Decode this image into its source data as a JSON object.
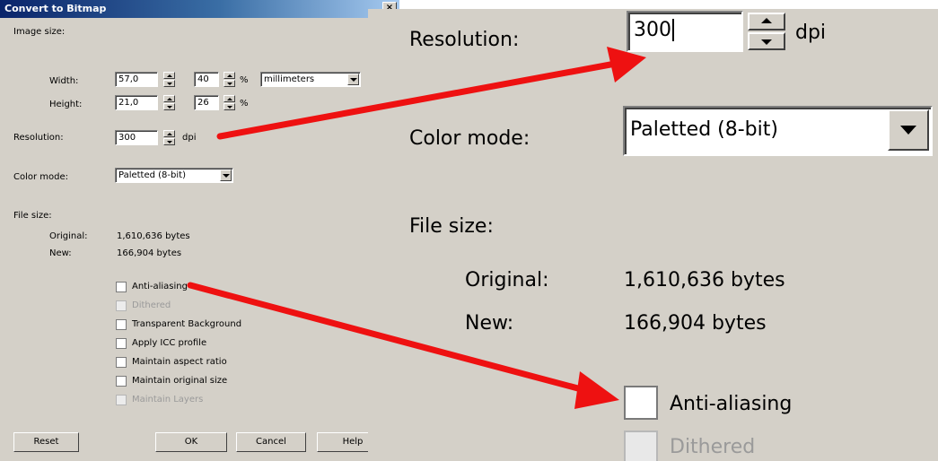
{
  "dialog": {
    "title": "Convert to Bitmap",
    "close_glyph": "×",
    "image_size_label": "Image size:",
    "width_label": "Width:",
    "width_value": "57,0",
    "width_percent": "40",
    "height_label": "Height:",
    "height_value": "21,0",
    "height_percent": "26",
    "percent_sign": "%",
    "units": "millimeters",
    "resolution_label": "Resolution:",
    "resolution_value": "300",
    "resolution_unit": "dpi",
    "color_mode_label": "Color mode:",
    "color_mode_value": "Paletted (8-bit)",
    "file_size_label": "File size:",
    "original_label": "Original:",
    "original_value": "1,610,636 bytes",
    "new_label": "New:",
    "new_value": "166,904 bytes",
    "checkboxes": [
      {
        "label": "Anti-aliasing",
        "enabled": true,
        "checked": false
      },
      {
        "label": "Dithered",
        "enabled": false,
        "checked": false
      },
      {
        "label": "Transparent Background",
        "enabled": true,
        "checked": false
      },
      {
        "label": "Apply ICC profile",
        "enabled": true,
        "checked": false
      },
      {
        "label": "Maintain aspect ratio",
        "enabled": true,
        "checked": false
      },
      {
        "label": "Maintain original size",
        "enabled": true,
        "checked": false
      },
      {
        "label": "Maintain Layers",
        "enabled": false,
        "checked": false
      }
    ],
    "buttons": {
      "reset": "Reset",
      "ok": "OK",
      "cancel": "Cancel",
      "help": "Help"
    }
  },
  "zoom": {
    "resolution_label": "Resolution:",
    "resolution_value": "300",
    "resolution_unit": "dpi",
    "color_mode_label": "Color mode:",
    "color_mode_value": "Paletted (8-bit)",
    "file_size_label": "File size:",
    "original_label": "Original:",
    "original_value": "1,610,636 bytes",
    "new_label": "New:",
    "new_value": "166,904 bytes",
    "anti_aliasing_label": "Anti-aliasing",
    "dithered_label": "Dithered"
  },
  "colors": {
    "dialog_bg": "#d4d0c8",
    "title_bar": "#0a246a",
    "annotation_arrow": "#ee1111",
    "disabled_text": "#9a9a9a"
  }
}
